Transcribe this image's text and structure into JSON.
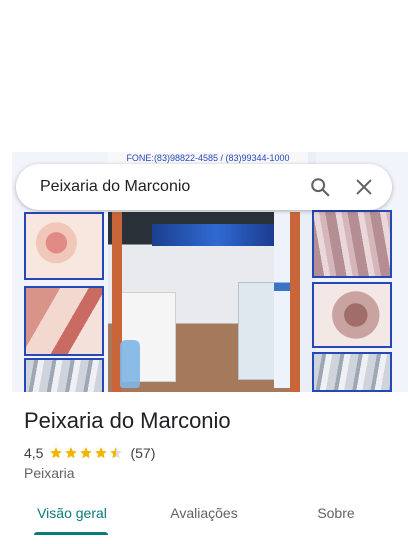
{
  "search": {
    "query": "Peixaria do Marconio"
  },
  "photo": {
    "sign_text": "FONE:(83)98822-4585 / (83)99344-1000"
  },
  "place": {
    "name": "Peixaria do Marconio",
    "rating": "4,5",
    "rating_value": 4.5,
    "review_count": "(57)",
    "category": "Peixaria"
  },
  "tabs": [
    {
      "label": "Visão geral",
      "active": true
    },
    {
      "label": "Avaliações",
      "active": false
    },
    {
      "label": "Sobre",
      "active": false
    }
  ],
  "colors": {
    "accent": "#0b7a7a",
    "star": "#f4b400"
  },
  "icons": {
    "search": "search-icon",
    "close": "close-icon"
  }
}
